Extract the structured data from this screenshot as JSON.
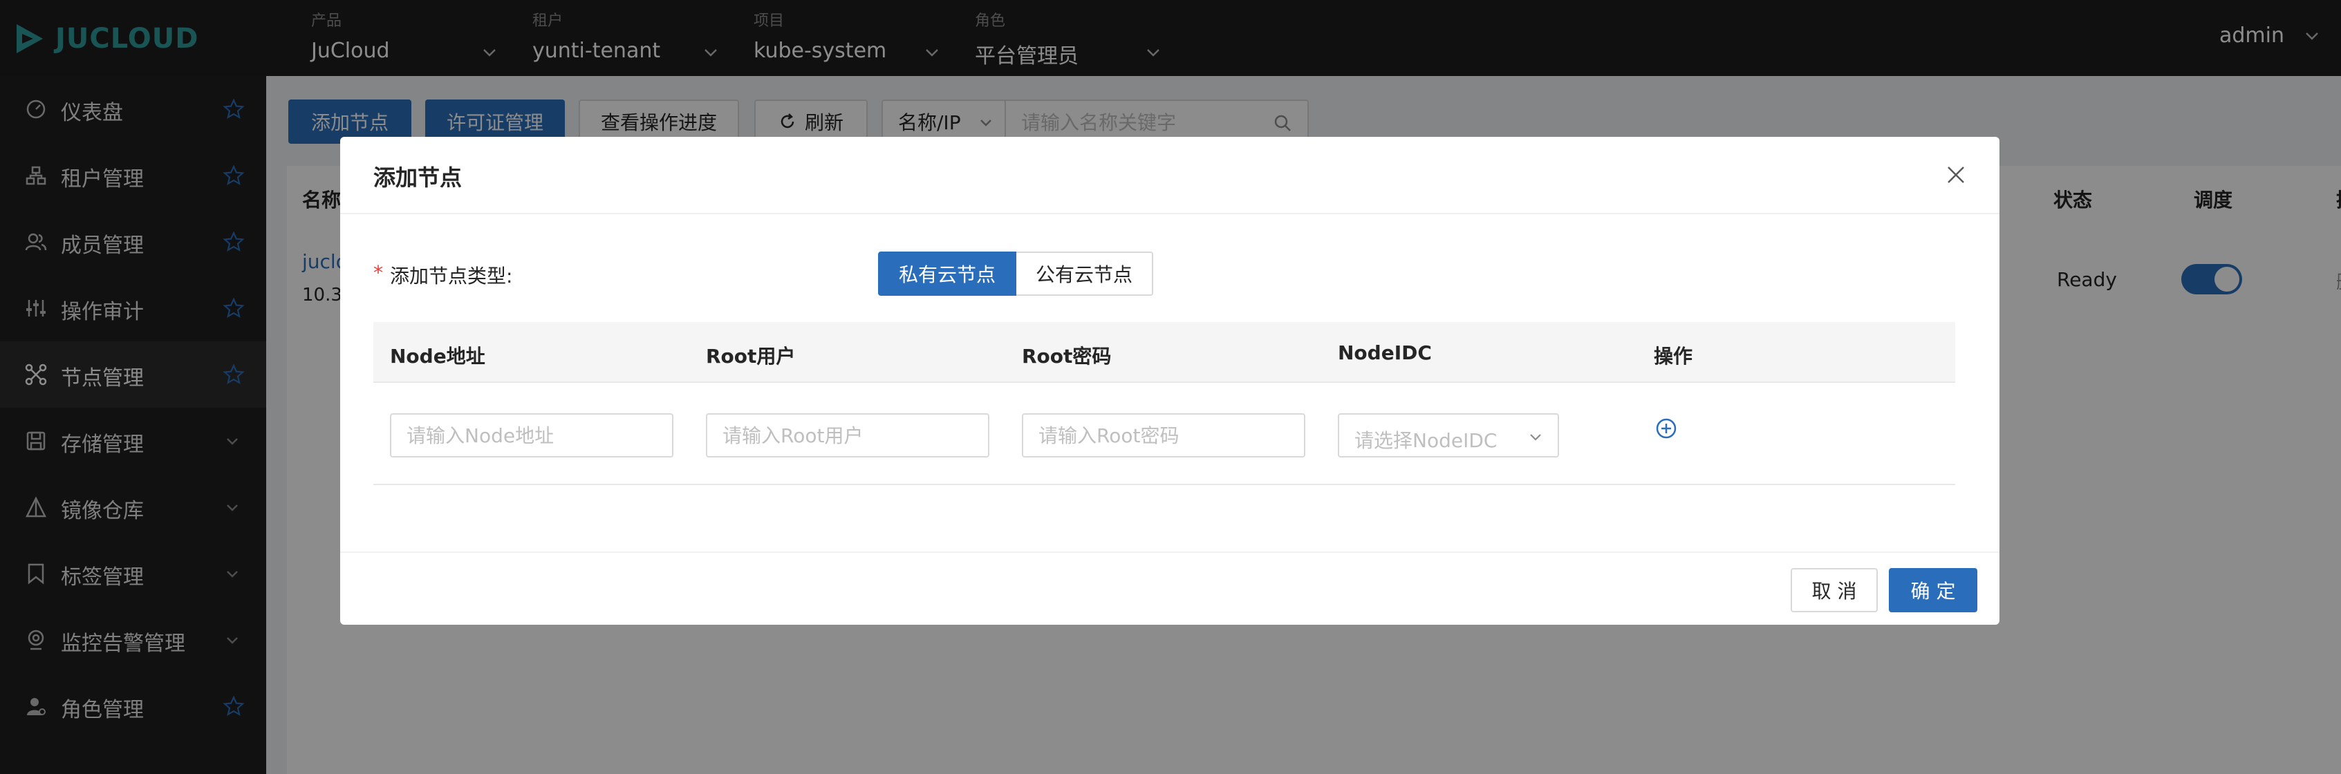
{
  "header": {
    "logo_text": "JUCLOUD",
    "selectors": [
      {
        "caption": "产品",
        "value": "JuCloud"
      },
      {
        "caption": "租户",
        "value": "yunti-tenant"
      },
      {
        "caption": "项目",
        "value": "kube-system"
      },
      {
        "caption": "角色",
        "value": "平台管理员"
      }
    ],
    "user": "admin"
  },
  "sidebar": {
    "items": [
      {
        "label": "仪表盘",
        "icon": "dashboard-icon",
        "trail": "star"
      },
      {
        "label": "租户管理",
        "icon": "tenant-icon",
        "trail": "star"
      },
      {
        "label": "成员管理",
        "icon": "members-icon",
        "trail": "star"
      },
      {
        "label": "操作审计",
        "icon": "audit-icon",
        "trail": "star"
      },
      {
        "label": "节点管理",
        "icon": "nodes-icon",
        "trail": "star",
        "active": true
      },
      {
        "label": "存储管理",
        "icon": "storage-icon",
        "trail": "chevron"
      },
      {
        "label": "镜像仓库",
        "icon": "registry-icon",
        "trail": "chevron"
      },
      {
        "label": "标签管理",
        "icon": "tag-icon",
        "trail": "chevron"
      },
      {
        "label": "监控告警管理",
        "icon": "monitor-icon",
        "trail": "chevron"
      },
      {
        "label": "角色管理",
        "icon": "role-icon",
        "trail": "star"
      }
    ]
  },
  "background": {
    "add_node": "添加节点",
    "license": "许可证管理",
    "progress": "查看操作进度",
    "refresh": "刷新",
    "filter_field": "名称/IP",
    "search_placeholder": "请输入名称关键字",
    "col_name": "名称",
    "col_status": "状态",
    "col_schedule": "调度",
    "col_ops_partial": "操",
    "row_name_partial": "juclo",
    "row_ip_partial": "10.3",
    "row_status": "Ready",
    "row_ops_partial": "删"
  },
  "modal": {
    "title": "添加节点",
    "form_required_mark": "*",
    "form_label": "添加节点类型:",
    "type_options": [
      "私有云节点",
      "公有云节点"
    ],
    "columns": [
      "Node地址",
      "Root用户",
      "Root密码",
      "NodeIDC",
      "操作"
    ],
    "placeholders": {
      "node_addr": "请输入Node地址",
      "root_user": "请输入Root用户",
      "root_pass": "请输入Root密码",
      "node_idc": "请选择NodeIDC"
    },
    "cancel": "取 消",
    "ok": "确 定"
  },
  "colors": {
    "primary": "#2a6ebb",
    "topbar": "#1e1e1e",
    "sidebar": "#1f1f1f",
    "logo": "#2e9b9b"
  }
}
